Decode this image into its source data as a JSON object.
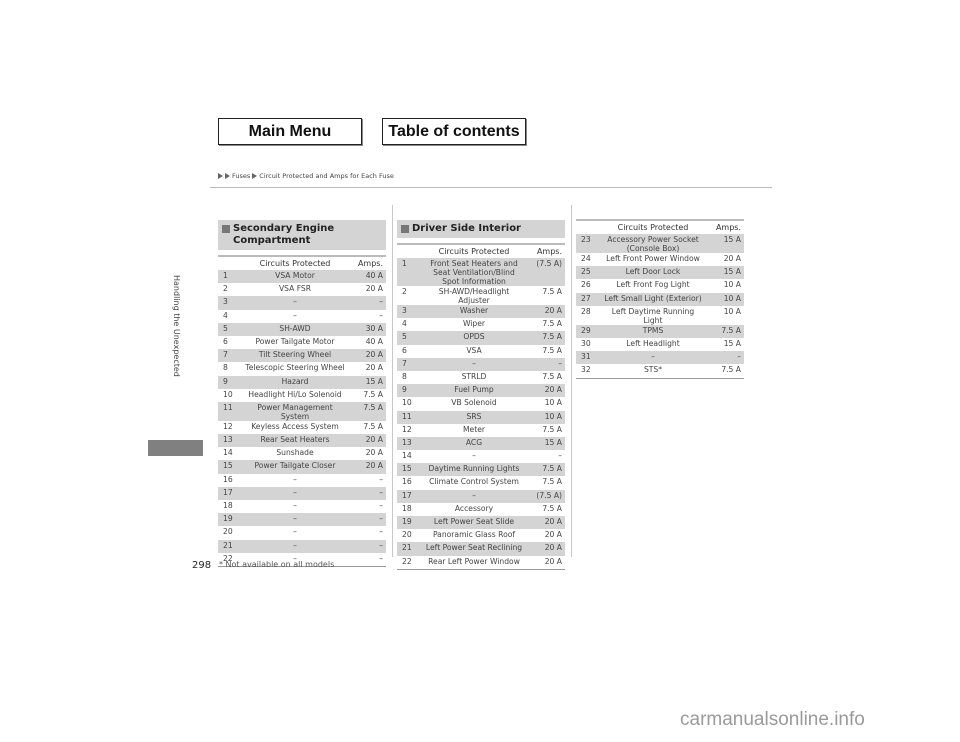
{
  "nav": {
    "main_menu": "Main Menu",
    "table_of_contents": "Table of contents"
  },
  "breadcrumb": {
    "items": [
      "Fuses",
      "Circuit Protected and Amps for Each Fuse"
    ]
  },
  "sidebar": {
    "chapter": "Handling the Unexpected"
  },
  "page": {
    "number": "298",
    "footnote": "* Not available on all models"
  },
  "watermark": "carmanualsonline.info",
  "columns": {
    "circuits": "Circuits Protected",
    "amps": "Amps."
  },
  "secondary_engine": {
    "title": "Secondary Engine Compartment",
    "rows": [
      {
        "n": "1",
        "c": "VSA Motor",
        "a": "40 A"
      },
      {
        "n": "2",
        "c": "VSA FSR",
        "a": "20 A"
      },
      {
        "n": "3",
        "c": "–",
        "a": "–"
      },
      {
        "n": "4",
        "c": "–",
        "a": "–"
      },
      {
        "n": "5",
        "c": "SH-AWD",
        "a": "30 A"
      },
      {
        "n": "6",
        "c": "Power Tailgate Motor",
        "a": "40 A"
      },
      {
        "n": "7",
        "c": "Tilt Steering Wheel",
        "a": "20 A"
      },
      {
        "n": "8",
        "c": "Telescopic Steering Wheel",
        "a": "20 A"
      },
      {
        "n": "9",
        "c": "Hazard",
        "a": "15 A"
      },
      {
        "n": "10",
        "c": "Headlight Hi/Lo Solenoid",
        "a": "7.5 A"
      },
      {
        "n": "11",
        "c": "Power Management System",
        "a": "7.5 A"
      },
      {
        "n": "12",
        "c": "Keyless Access System",
        "a": "7.5 A"
      },
      {
        "n": "13",
        "c": "Rear Seat Heaters",
        "a": "20 A"
      },
      {
        "n": "14",
        "c": "Sunshade",
        "a": "20 A"
      },
      {
        "n": "15",
        "c": "Power Tailgate Closer",
        "a": "20 A"
      },
      {
        "n": "16",
        "c": "–",
        "a": "–"
      },
      {
        "n": "17",
        "c": "–",
        "a": "–"
      },
      {
        "n": "18",
        "c": "–",
        "a": "–"
      },
      {
        "n": "19",
        "c": "–",
        "a": "–"
      },
      {
        "n": "20",
        "c": "–",
        "a": "–"
      },
      {
        "n": "21",
        "c": "–",
        "a": "–"
      },
      {
        "n": "22",
        "c": "–",
        "a": "–"
      }
    ]
  },
  "driver_side": {
    "title": "Driver Side Interior",
    "rows": [
      {
        "n": "1",
        "c": "Front Seat Heaters and Seat Ventilation/Blind Spot Information",
        "a": "(7.5 A)"
      },
      {
        "n": "2",
        "c": "SH-AWD/Headlight Adjuster",
        "a": "7.5 A"
      },
      {
        "n": "3",
        "c": "Washer",
        "a": "20 A"
      },
      {
        "n": "4",
        "c": "Wiper",
        "a": "7.5 A"
      },
      {
        "n": "5",
        "c": "OPDS",
        "a": "7.5 A"
      },
      {
        "n": "6",
        "c": "VSA",
        "a": "7.5 A"
      },
      {
        "n": "7",
        "c": "–",
        "a": "–"
      },
      {
        "n": "8",
        "c": "STRLD",
        "a": "7.5 A"
      },
      {
        "n": "9",
        "c": "Fuel Pump",
        "a": "20 A"
      },
      {
        "n": "10",
        "c": "VB Solenoid",
        "a": "10 A"
      },
      {
        "n": "11",
        "c": "SRS",
        "a": "10 A"
      },
      {
        "n": "12",
        "c": "Meter",
        "a": "7.5 A"
      },
      {
        "n": "13",
        "c": "ACG",
        "a": "15 A"
      },
      {
        "n": "14",
        "c": "–",
        "a": "–"
      },
      {
        "n": "15",
        "c": "Daytime Running Lights",
        "a": "7.5 A"
      },
      {
        "n": "16",
        "c": "Climate Control System",
        "a": "7.5 A"
      },
      {
        "n": "17",
        "c": "–",
        "a": "(7.5 A)"
      },
      {
        "n": "18",
        "c": "Accessory",
        "a": "7.5 A"
      },
      {
        "n": "19",
        "c": "Left Power Seat Slide",
        "a": "20 A"
      },
      {
        "n": "20",
        "c": "Panoramic Glass Roof",
        "a": "20 A"
      },
      {
        "n": "21",
        "c": "Left Power Seat Reclining",
        "a": "20 A"
      },
      {
        "n": "22",
        "c": "Rear Left Power Window",
        "a": "20 A"
      }
    ]
  },
  "driver_side_cont": {
    "rows": [
      {
        "n": "23",
        "c": "Accessory Power Socket (Console Box)",
        "a": "15 A"
      },
      {
        "n": "24",
        "c": "Left Front Power Window",
        "a": "20 A"
      },
      {
        "n": "25",
        "c": "Left Door Lock",
        "a": "15 A"
      },
      {
        "n": "26",
        "c": "Left Front Fog Light",
        "a": "10 A"
      },
      {
        "n": "27",
        "c": "Left Small Light (Exterior)",
        "a": "10 A"
      },
      {
        "n": "28",
        "c": "Left Daytime Running Light",
        "a": "10 A"
      },
      {
        "n": "29",
        "c": "TPMS",
        "a": "7.5 A"
      },
      {
        "n": "30",
        "c": "Left Headlight",
        "a": "15 A"
      },
      {
        "n": "31",
        "c": "–",
        "a": "–"
      },
      {
        "n": "32",
        "c": "STS*",
        "a": "7.5 A"
      }
    ]
  }
}
